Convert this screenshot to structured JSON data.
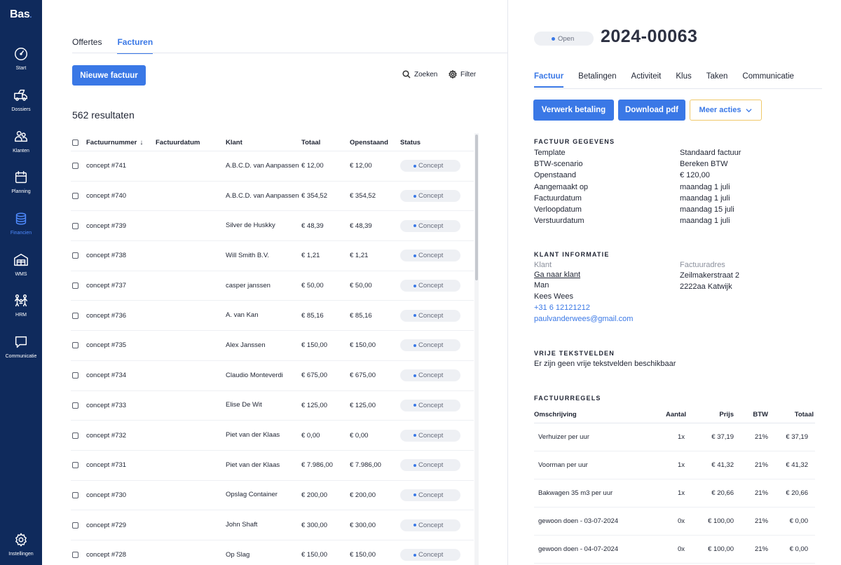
{
  "sidebar": {
    "logo": "Bas",
    "items": [
      {
        "label": "Start",
        "icon": "gauge-icon"
      },
      {
        "label": "Dossiers",
        "icon": "truck-icon"
      },
      {
        "label": "Klanten",
        "icon": "users-icon"
      },
      {
        "label": "Planning",
        "icon": "calendar-icon"
      },
      {
        "label": "Financien",
        "icon": "coins-icon",
        "active": true
      },
      {
        "label": "WMS",
        "icon": "warehouse-icon"
      },
      {
        "label": "HRM",
        "icon": "team-icon"
      },
      {
        "label": "Communicatie",
        "icon": "chat-icon"
      }
    ],
    "settings_label": "Instellingen"
  },
  "list": {
    "tabs": [
      "Offertes",
      "Facturen"
    ],
    "active_tab": "Facturen",
    "new_button": "Nieuwe factuur",
    "search_label": "Zoeken",
    "filter_label": "Filter",
    "results": "562 resultaten",
    "columns": [
      "Factuurnummer",
      "Factuurdatum",
      "Klant",
      "Totaal",
      "Openstaand",
      "Status"
    ],
    "rows": [
      {
        "number": "concept #741",
        "date": "",
        "klant": "A.B.C.D. van Aanpassen",
        "totaal": "€ 12,00",
        "open": "€ 12,00",
        "status": "Concept"
      },
      {
        "number": "concept #740",
        "date": "",
        "klant": "A.B.C.D. van Aanpassen",
        "totaal": "€ 354,52",
        "open": "€ 354,52",
        "status": "Concept"
      },
      {
        "number": "concept #739",
        "date": "",
        "klant": "Silver de Huskky",
        "totaal": "€ 48,39",
        "open": "€ 48,39",
        "status": "Concept"
      },
      {
        "number": "concept #738",
        "date": "",
        "klant": "Will Smith B.V.",
        "totaal": "€ 1,21",
        "open": "€ 1,21",
        "status": "Concept"
      },
      {
        "number": "concept #737",
        "date": "",
        "klant": "casper janssen",
        "totaal": "€ 50,00",
        "open": "€ 50,00",
        "status": "Concept"
      },
      {
        "number": "concept #736",
        "date": "",
        "klant": "A. van Kan",
        "totaal": "€ 85,16",
        "open": "€ 85,16",
        "status": "Concept"
      },
      {
        "number": "concept #735",
        "date": "",
        "klant": "Alex Janssen",
        "totaal": "€ 150,00",
        "open": "€ 150,00",
        "status": "Concept"
      },
      {
        "number": "concept #734",
        "date": "",
        "klant": "Claudio Monteverdi",
        "totaal": "€ 675,00",
        "open": "€ 675,00",
        "status": "Concept"
      },
      {
        "number": "concept #733",
        "date": "",
        "klant": "Elise De Wit",
        "totaal": "€ 125,00",
        "open": "€ 125,00",
        "status": "Concept"
      },
      {
        "number": "concept #732",
        "date": "",
        "klant": "Piet van der Klaas",
        "totaal": "€ 0,00",
        "open": "€ 0,00",
        "status": "Concept"
      },
      {
        "number": "concept #731",
        "date": "",
        "klant": "Piet van der Klaas",
        "totaal": "€ 7.986,00",
        "open": "€ 7.986,00",
        "status": "Concept"
      },
      {
        "number": "concept #730",
        "date": "",
        "klant": "Opslag Container",
        "totaal": "€ 200,00",
        "open": "€ 200,00",
        "status": "Concept"
      },
      {
        "number": "concept #729",
        "date": "",
        "klant": "John Shaft",
        "totaal": "€ 300,00",
        "open": "€ 300,00",
        "status": "Concept"
      },
      {
        "number": "concept #728",
        "date": "",
        "klant": "Op Slag",
        "totaal": "€ 150,00",
        "open": "€ 150,00",
        "status": "Concept"
      }
    ]
  },
  "detail": {
    "status": "Open",
    "invoice_number": "2024-00063",
    "tabs": [
      "Factuur",
      "Betalingen",
      "Activiteit",
      "Klus",
      "Taken",
      "Communicatie"
    ],
    "active_tab": "Factuur",
    "actions": {
      "process_payment": "Verwerk betaling",
      "download_pdf": "Download pdf",
      "more_actions": "Meer acties"
    },
    "invoice_details": {
      "title": "FACTUUR GEGEVENS",
      "rows": [
        {
          "label": "Template",
          "value": "Standaard factuur"
        },
        {
          "label": "BTW-scenario",
          "value": "Bereken BTW"
        },
        {
          "label": "Openstaand",
          "value": "€ 120,00"
        },
        {
          "label": "Aangemaakt op",
          "value": "maandag 1 juli"
        },
        {
          "label": "Factuurdatum",
          "value": "maandag 1 juli"
        },
        {
          "label": "Verloopdatum",
          "value": "maandag 15 juli"
        },
        {
          "label": "Verstuurdatum",
          "value": "maandag 1 juli"
        }
      ]
    },
    "client": {
      "title": "KLANT INFORMATIE",
      "client_label": "Klant",
      "goto_client": "Ga naar klant",
      "salutation": "Man",
      "name": "Kees Wees",
      "phone": "+31 6 12121212",
      "email": "paulvanderwees@gmail.com",
      "address_label": "Factuuradres",
      "street": "Zeilmakerstraat 2",
      "city": "2222aa Katwijk"
    },
    "free_fields": {
      "title": "VRIJE TEKSTVELDEN",
      "empty_text": "Er zijn geen vrije tekstvelden beschikbaar"
    },
    "lines": {
      "title": "FACTUURREGELS",
      "columns": [
        "Omschrijving",
        "Aantal",
        "Prijs",
        "BTW",
        "Totaal"
      ],
      "rows": [
        {
          "desc": "Verhuizer per uur",
          "qty": "1x",
          "price": "€ 37,19",
          "btw": "21%",
          "total": "€ 37,19"
        },
        {
          "desc": "Voorman per uur",
          "qty": "1x",
          "price": "€ 41,32",
          "btw": "21%",
          "total": "€ 41,32"
        },
        {
          "desc": "Bakwagen 35 m3 per uur",
          "qty": "1x",
          "price": "€ 20,66",
          "btw": "21%",
          "total": "€ 20,66"
        },
        {
          "desc": "gewoon doen - 03-07-2024",
          "qty": "0x",
          "price": "€ 100,00",
          "btw": "21%",
          "total": "€ 0,00"
        },
        {
          "desc": "gewoon doen - 04-07-2024",
          "qty": "0x",
          "price": "€ 100,00",
          "btw": "21%",
          "total": "€ 0,00"
        }
      ]
    }
  }
}
